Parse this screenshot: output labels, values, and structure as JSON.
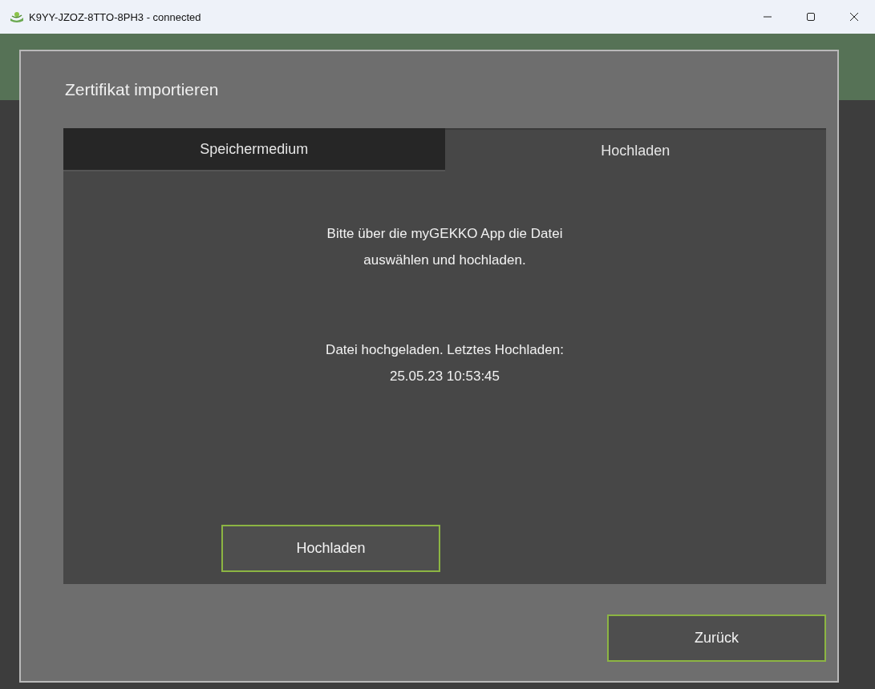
{
  "window": {
    "title": "K9YY-JZOZ-8TTO-8PH3 - connected"
  },
  "dialog": {
    "title": "Zertifikat importieren",
    "tabs": [
      {
        "label": "Speichermedium",
        "selected": false
      },
      {
        "label": "Hochladen",
        "selected": true
      }
    ],
    "messages": [
      {
        "lines": [
          "Bitte über die myGEKKO App die Datei",
          "auswählen und hochladen."
        ]
      },
      {
        "lines": [
          "Datei hochgeladen. Letztes Hochladen:",
          "25.05.23 10:53:45"
        ]
      }
    ],
    "upload_button": "Hochladen",
    "back_button": "Zurück"
  }
}
